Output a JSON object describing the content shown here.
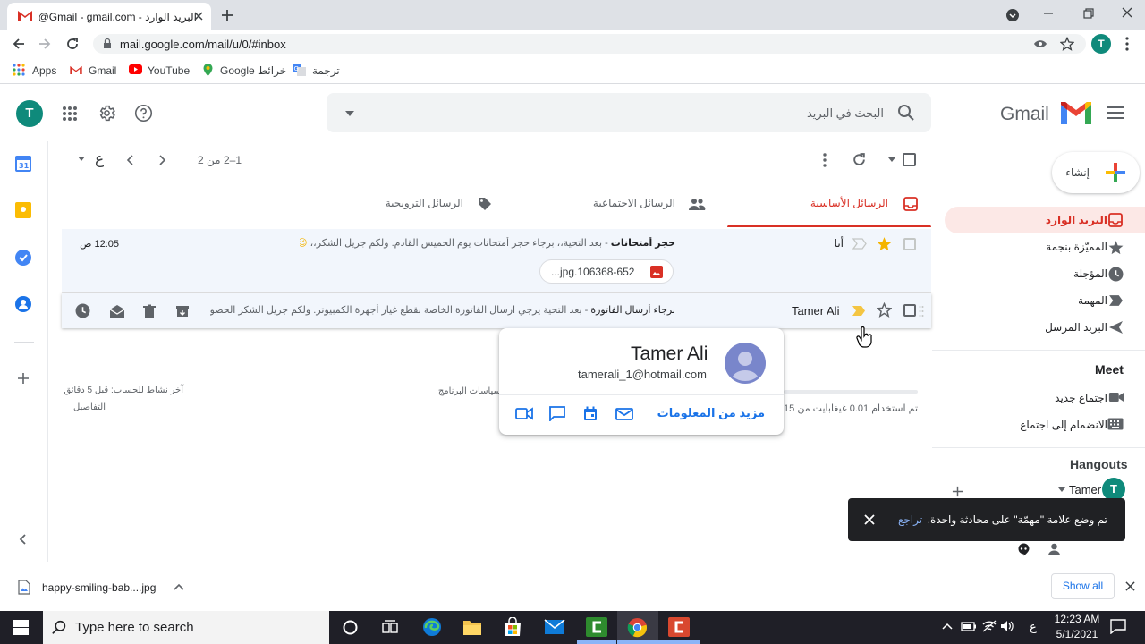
{
  "browser": {
    "tab_title": "‏البريد الوارد - Gmail - ‎gmail.com@",
    "url": "mail.google.com/mail/u/0/#inbox",
    "profile_initial": "T",
    "bookmarks": [
      {
        "label": "Apps"
      },
      {
        "label": "Gmail"
      },
      {
        "label": "YouTube"
      },
      {
        "label": "Google خرائط"
      },
      {
        "label": "ترجمة"
      }
    ]
  },
  "header": {
    "search_placeholder": "البحث في البريد",
    "logo_text": "Gmail",
    "account_initial": "T"
  },
  "compose": {
    "label": "إنشاء"
  },
  "sidebar": {
    "items": [
      {
        "label": "البريد الوارد"
      },
      {
        "label": "المميّزة بنجمة"
      },
      {
        "label": "المؤجلة"
      },
      {
        "label": "المهمة"
      },
      {
        "label": "البريد المرسل"
      }
    ],
    "meet": {
      "title": "Meet",
      "new_meeting": "اجتماع جديد",
      "join_meeting": "الانضمام إلى اجتماع"
    },
    "hangouts": {
      "title": "Hangouts",
      "user": "Tamer",
      "user_initial": "T"
    }
  },
  "toolbar": {
    "pagination": "1–2 من 2",
    "input_tool": "ع"
  },
  "tabs": [
    {
      "label": "الرسائل الأساسية"
    },
    {
      "label": "الرسائل الاجتماعية"
    },
    {
      "label": "الرسائل الترويجية"
    }
  ],
  "emails": [
    {
      "sender": "أنا",
      "subject": "حجز أمتحانات",
      "snippet": " - بعد التحية،، برجاء حجز أمتحانات يوم الخميس القادم. ولكم جزيل الشكر،، ",
      "time": "12:05 ص",
      "attachment": "106368-652.jpg..."
    },
    {
      "sender": "Tamer Ali",
      "subject": "برجاء أرسال الفاتورة",
      "snippet": " - بعد التحية يرجي ارسال الفاتورة الخاصة بقطع غيار أجهزة الكمبيوتر. ولكم جزيل الشكر الحصو...",
      "time": ""
    }
  ],
  "footer": {
    "storage": "تم استخدام 0.01 غيغابايت من 15 غيغ",
    "policies": "· سياسات البرنامج",
    "last_activity": "آخر نشاط للحساب: قبل 5 دقائق",
    "details": "التفاصيل"
  },
  "popup": {
    "name": "Tamer Ali",
    "email": "tamerali_1@hotmail.com",
    "more_info": "مزيد من المعلومات"
  },
  "snackbar": {
    "message": "تم وضع علامة \"مهمّة\" على محادثة واحدة.",
    "undo": "تراجع"
  },
  "downloads": {
    "file": "happy-smiling-bab....jpg",
    "show_all": "Show all"
  },
  "taskbar": {
    "search_placeholder": "Type here to search",
    "time": "12:23 AM",
    "date": "5/1/2021",
    "lang": "ع"
  },
  "colors": {
    "gmail_red": "#d93025",
    "star_yellow": "#f4b400",
    "important_yellow": "#f4c542",
    "link_blue": "#1a73e8",
    "avatar_teal": "#0f8a7b"
  }
}
